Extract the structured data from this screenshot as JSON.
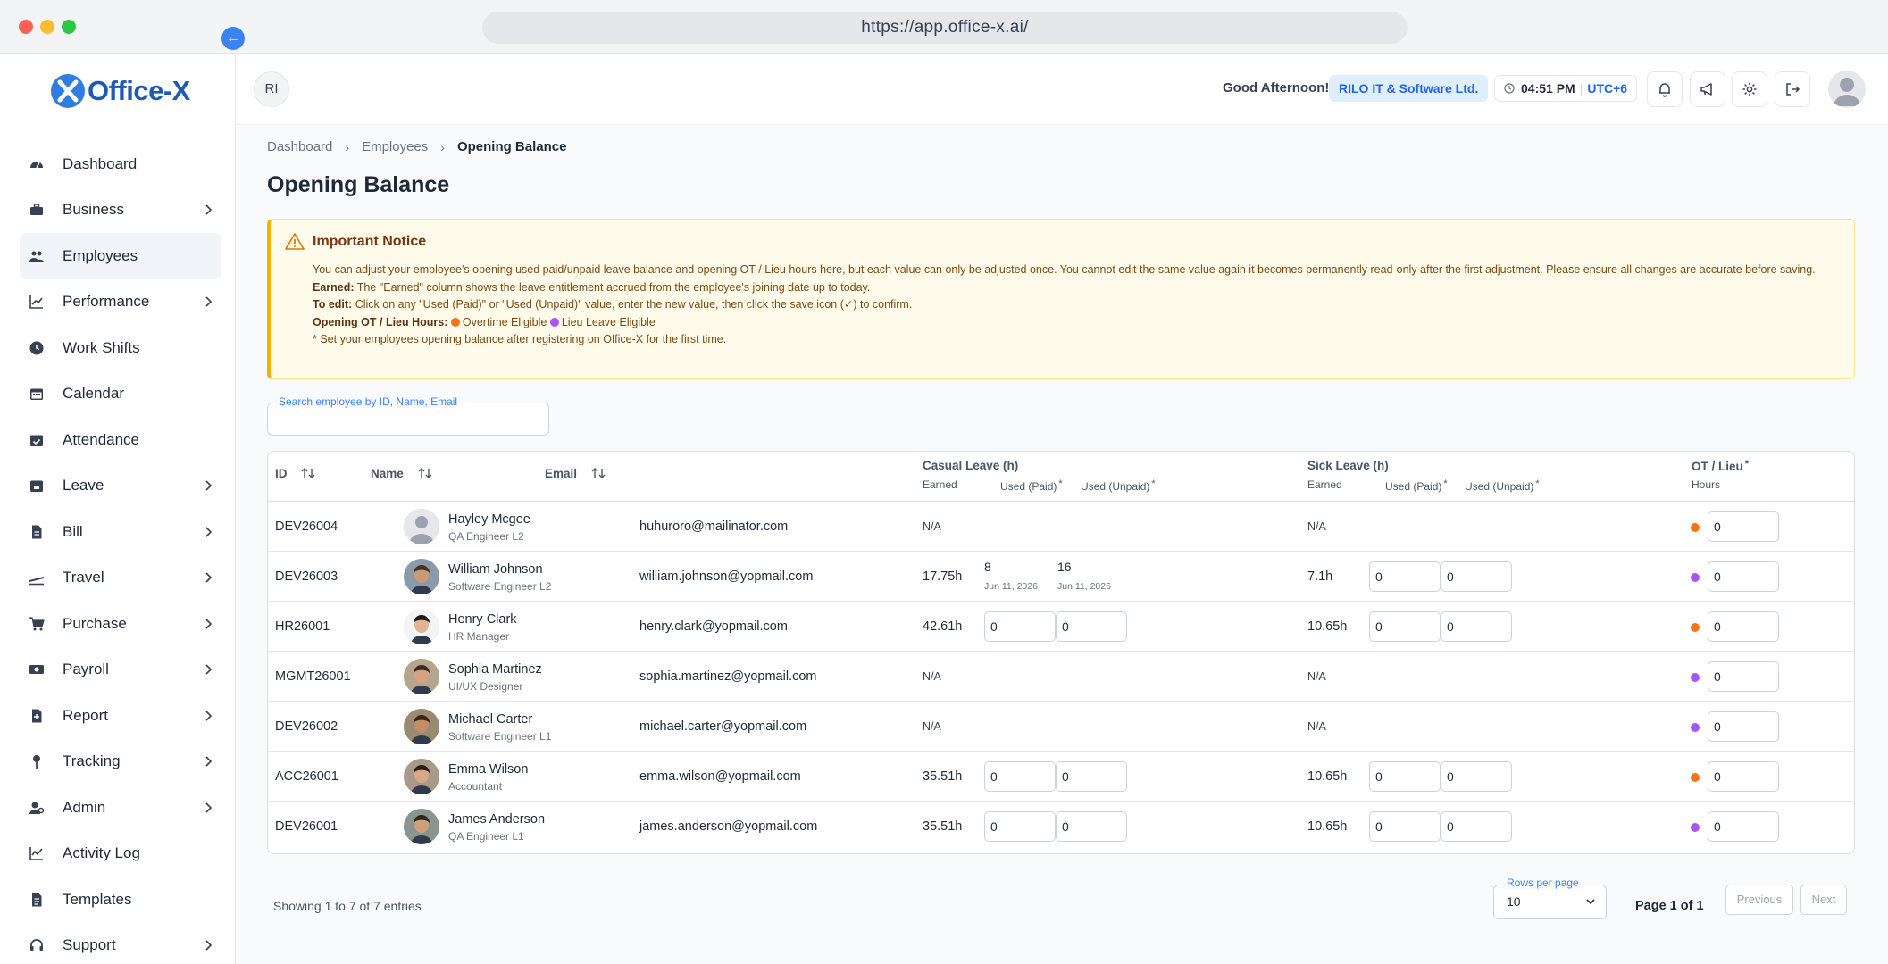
{
  "browser": {
    "url": "https://app.office-x.ai/"
  },
  "brand": {
    "name": "Office-X",
    "primary": "#1e5bb8",
    "accent": "#3b82f6"
  },
  "sidebar": {
    "items": [
      {
        "label": "Dashboard",
        "icon": "dashboard-icon",
        "chevron": false
      },
      {
        "label": "Business",
        "icon": "briefcase-icon",
        "chevron": true
      },
      {
        "label": "Employees",
        "icon": "users-icon",
        "chevron": false,
        "active": true
      },
      {
        "label": "Performance",
        "icon": "chart-line-icon",
        "chevron": true
      },
      {
        "label": "Work Shifts",
        "icon": "clock-icon",
        "chevron": false
      },
      {
        "label": "Calendar",
        "icon": "calendar-icon",
        "chevron": false
      },
      {
        "label": "Attendance",
        "icon": "calendar-check-icon",
        "chevron": false
      },
      {
        "label": "Leave",
        "icon": "calendar-leave-icon",
        "chevron": true
      },
      {
        "label": "Bill",
        "icon": "file-icon",
        "chevron": true
      },
      {
        "label": "Travel",
        "icon": "plane-icon",
        "chevron": true
      },
      {
        "label": "Purchase",
        "icon": "cart-icon",
        "chevron": true
      },
      {
        "label": "Payroll",
        "icon": "money-icon",
        "chevron": true
      },
      {
        "label": "Report",
        "icon": "report-icon",
        "chevron": true
      },
      {
        "label": "Tracking",
        "icon": "pin-icon",
        "chevron": true
      },
      {
        "label": "Admin",
        "icon": "admin-icon",
        "chevron": true
      },
      {
        "label": "Activity Log",
        "icon": "activity-icon",
        "chevron": false
      },
      {
        "label": "Templates",
        "icon": "template-icon",
        "chevron": false
      },
      {
        "label": "Support",
        "icon": "headset-icon",
        "chevron": true
      }
    ]
  },
  "header": {
    "user_initials": "RI",
    "greeting": "Good Afternoon!",
    "company": "RILO IT & Software Ltd.",
    "time": "04:51 PM",
    "timezone": "UTC+6"
  },
  "breadcrumb": {
    "items": [
      "Dashboard",
      "Employees"
    ],
    "current": "Opening Balance"
  },
  "page": {
    "title": "Opening Balance"
  },
  "notice": {
    "title": "Important Notice",
    "line1": "You can adjust your employee's opening used paid/unpaid leave balance and opening OT / Lieu hours here, but each value can only be adjusted once. You cannot edit the same value again it becomes permanently read-only after the first adjustment. Please ensure all changes are accurate before saving.",
    "earned_label": "Earned:",
    "earned_text": "The \"Earned\" column shows the leave entitlement accrued from the employee's joining date up to today.",
    "edit_label": "To edit:",
    "edit_text": "Click on any \"Used (Paid)\" or \"Used (Unpaid)\" value, enter the new value, then click the save icon (✓) to confirm.",
    "ot_label": "Opening OT / Lieu Hours:",
    "ot_overtime": "Overtime Eligible",
    "ot_lieu": "Lieu Leave Eligible",
    "footnote": "* Set your employees opening balance after registering on Office-X for the first time."
  },
  "search": {
    "label": "Search employee by ID, Name, Email",
    "value": ""
  },
  "table": {
    "headers": {
      "id": "ID",
      "name": "Name",
      "email": "Email",
      "casual": "Casual Leave (h)",
      "sick": "Sick Leave (h)",
      "ot": "OT / Lieu",
      "earned": "Earned",
      "used_paid": "Used (Paid)",
      "used_unpaid": "Used (Unpaid)",
      "hours": "Hours",
      "asterisk": "*"
    },
    "rows": [
      {
        "id": "DEV26004",
        "name": "Hayley Mcgee",
        "role": "QA Engineer L2",
        "email": "huhuroro@mailinator.com",
        "casual_earned": "N/A",
        "casual_paid": "",
        "casual_unpaid": "",
        "sick_earned": "N/A",
        "sick_paid": "",
        "sick_unpaid": "",
        "ot_type": "overtime",
        "ot_hours": "0"
      },
      {
        "id": "DEV26003",
        "name": "William Johnson",
        "role": "Software Engineer L2",
        "email": "william.johnson@yopmail.com",
        "casual_earned": "17.75h",
        "casual_paid": "8",
        "casual_paid_date": "Jun 11, 2026",
        "casual_unpaid": "16",
        "casual_unpaid_date": "Jun 11, 2026",
        "sick_earned": "7.1h",
        "sick_paid": "0",
        "sick_unpaid": "0",
        "ot_type": "lieu",
        "ot_hours": "0"
      },
      {
        "id": "HR26001",
        "name": "Henry Clark",
        "role": "HR Manager",
        "email": "henry.clark@yopmail.com",
        "casual_earned": "42.61h",
        "casual_paid": "0",
        "casual_unpaid": "0",
        "sick_earned": "10.65h",
        "sick_paid": "0",
        "sick_unpaid": "0",
        "ot_type": "overtime",
        "ot_hours": "0"
      },
      {
        "id": "MGMT26001",
        "name": "Sophia Martinez",
        "role": "UI/UX Designer",
        "email": "sophia.martinez@yopmail.com",
        "casual_earned": "N/A",
        "casual_paid": "",
        "casual_unpaid": "",
        "sick_earned": "N/A",
        "sick_paid": "",
        "sick_unpaid": "",
        "ot_type": "lieu",
        "ot_hours": "0"
      },
      {
        "id": "DEV26002",
        "name": "Michael Carter",
        "role": "Software Engineer L1",
        "email": "michael.carter@yopmail.com",
        "casual_earned": "N/A",
        "casual_paid": "",
        "casual_unpaid": "",
        "sick_earned": "N/A",
        "sick_paid": "",
        "sick_unpaid": "",
        "ot_type": "lieu",
        "ot_hours": "0"
      },
      {
        "id": "ACC26001",
        "name": "Emma Wilson",
        "role": "Accountant",
        "email": "emma.wilson@yopmail.com",
        "casual_earned": "35.51h",
        "casual_paid": "0",
        "casual_unpaid": "0",
        "sick_earned": "10.65h",
        "sick_paid": "0",
        "sick_unpaid": "0",
        "ot_type": "overtime",
        "ot_hours": "0"
      },
      {
        "id": "DEV26001",
        "name": "James Anderson",
        "role": "QA Engineer L1",
        "email": "james.anderson@yopmail.com",
        "casual_earned": "35.51h",
        "casual_paid": "0",
        "casual_unpaid": "0",
        "sick_earned": "10.65h",
        "sick_paid": "0",
        "sick_unpaid": "0",
        "ot_type": "lieu",
        "ot_hours": "0"
      }
    ]
  },
  "footer": {
    "showing": "Showing 1 to 7 of 7 entries",
    "rows_per_page_label": "Rows per page",
    "rows_per_page": "10",
    "page_info": "Page 1 of 1",
    "previous": "Previous",
    "next": "Next"
  },
  "colors": {
    "overtime": "#f97316",
    "lieu": "#a855f7",
    "notice_bg": "#fffbea",
    "notice_border": "#f5b100"
  }
}
